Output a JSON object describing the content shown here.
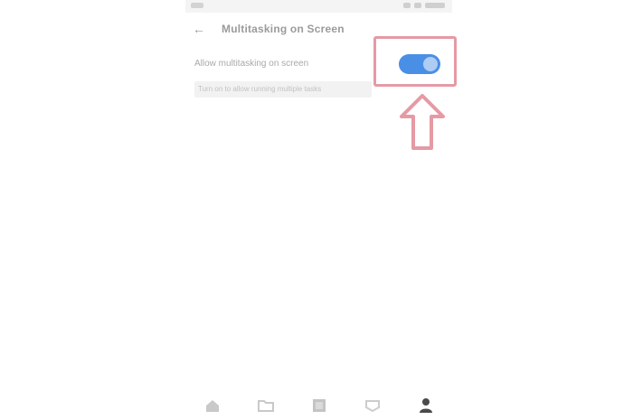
{
  "status_bar": {
    "time": "",
    "icons": [
      "signal-icon",
      "wifi-icon",
      "battery-icon"
    ]
  },
  "header": {
    "back_icon": "arrow-left-icon",
    "title": "Multitasking on Screen"
  },
  "setting": {
    "label": "Allow multitasking on screen",
    "description": "Turn on to allow running multiple tasks",
    "toggle_on": true
  },
  "bottom_nav": {
    "items": [
      {
        "icon": "home-icon"
      },
      {
        "icon": "folder-icon"
      },
      {
        "icon": "grid-icon"
      },
      {
        "icon": "tag-icon"
      },
      {
        "icon": "profile-icon"
      }
    ]
  },
  "colors": {
    "toggle_on": "#4a8fe6",
    "highlight": "#e59aa4"
  }
}
